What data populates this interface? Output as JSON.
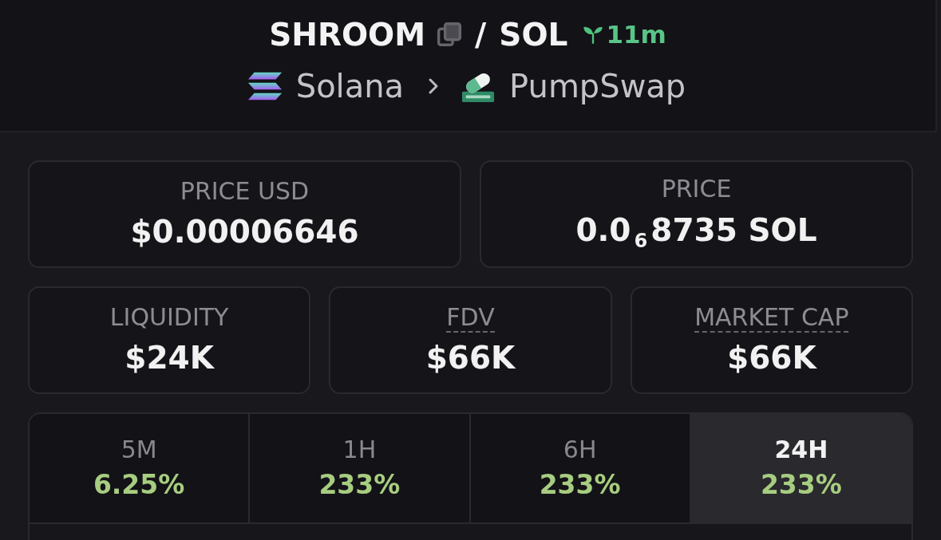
{
  "pair": {
    "base": "SHROOM",
    "separator": "/",
    "quote": "SOL",
    "age": "11m"
  },
  "route": {
    "chain": "Solana",
    "dex": "PumpSwap"
  },
  "stat_rows": [
    [
      {
        "label": "PRICE USD",
        "value": "$0.00006646",
        "dotted_underline": false
      },
      {
        "label": "PRICE",
        "value": "0.0$_{6}$8735 SOL",
        "dotted_underline": false
      }
    ],
    [
      {
        "label": "LIQUIDITY",
        "value": "$24K",
        "dotted_underline": false
      },
      {
        "label": "FDV",
        "value": "$66K",
        "dotted_underline": true
      },
      {
        "label": "MARKET CAP",
        "value": "$66K",
        "dotted_underline": true
      }
    ]
  ],
  "timeframes": [
    {
      "label": "5M",
      "change": "6.25%",
      "selected": false
    },
    {
      "label": "1H",
      "change": "233%",
      "selected": false
    },
    {
      "label": "6H",
      "change": "233%",
      "selected": false
    },
    {
      "label": "24H",
      "change": "233%",
      "selected": true
    }
  ]
}
